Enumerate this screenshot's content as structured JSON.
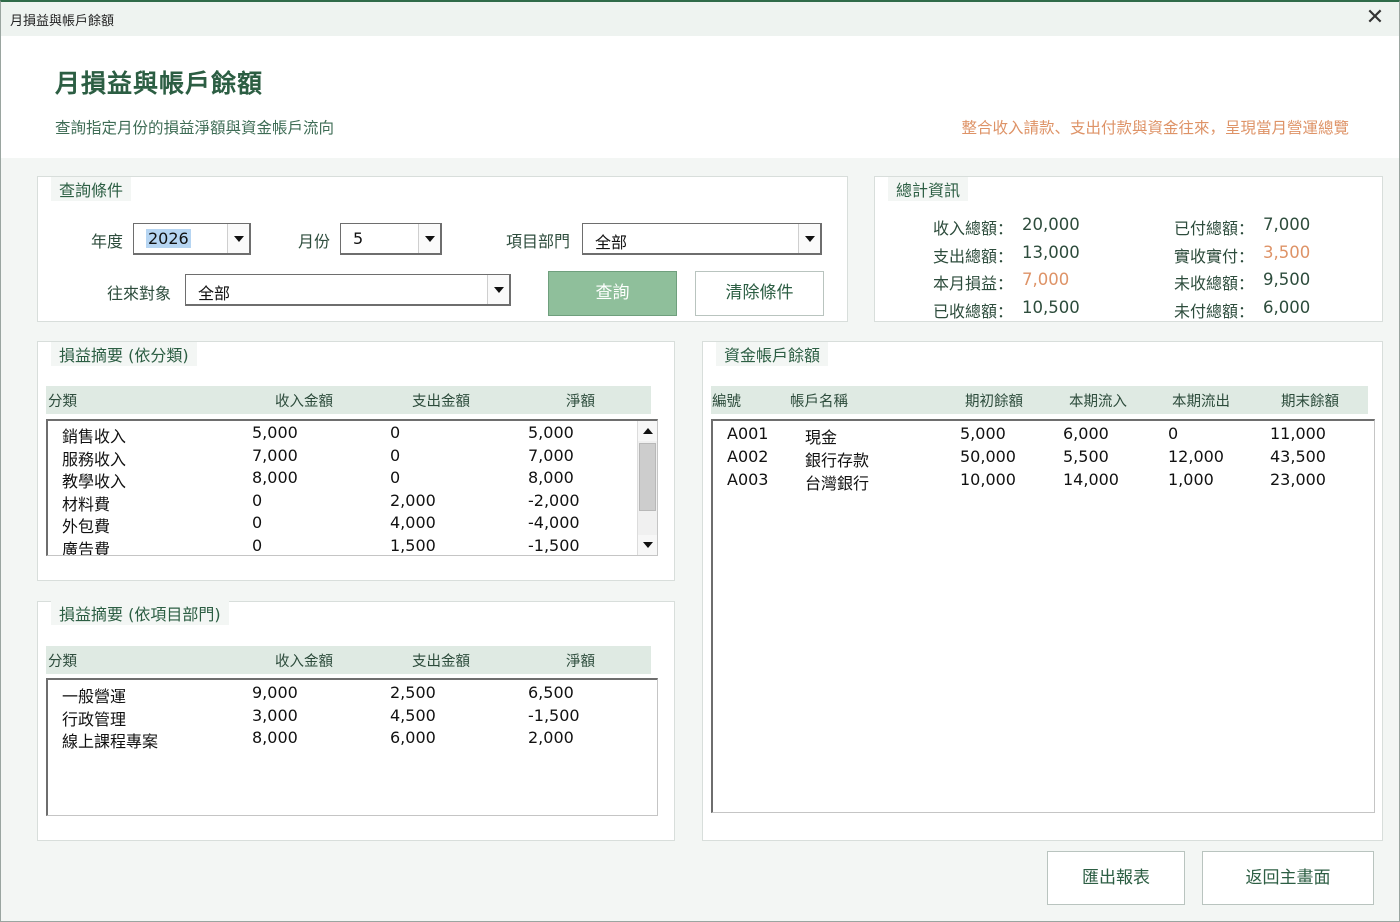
{
  "window": {
    "title": "月損益與帳戶餘額",
    "close_glyph": "✕"
  },
  "banner": {
    "heading": "月損益與帳戶餘額",
    "subtitle": "查詢指定月份的損益淨額與資金帳戶流向",
    "tagline": "整合收入請款、支出付款與資金往來，呈現當月營運總覽"
  },
  "query": {
    "frame_label": "查詢條件",
    "year_label": "年度",
    "year_value": "2026",
    "month_label": "月份",
    "month_value": "5",
    "dept_label": "項目部門",
    "dept_value": "全部",
    "party_label": "往來對象",
    "party_value": "全部",
    "search_button": "查詢",
    "clear_button": "清除條件"
  },
  "totals": {
    "frame_label": "總計資訊",
    "income_label": "收入總額：",
    "income_value": "20,000",
    "expense_label": "支出總額：",
    "expense_value": "13,000",
    "profit_label": "本月損益：",
    "profit_value": "7,000",
    "received_label": "已收總額：",
    "received_value": "10,500",
    "paid_label": "已付總額：",
    "paid_value": "7,000",
    "net_cash_label": "實收實付：",
    "net_cash_value": "3,500",
    "unreceived_label": "未收總額：",
    "unreceived_value": "9,500",
    "unpaid_label": "未付總額：",
    "unpaid_value": "6,000"
  },
  "by_category": {
    "frame_label": "損益摘要 (依分類)",
    "headers": [
      "分類",
      "收入金額",
      "支出金額",
      "淨額"
    ],
    "rows": [
      [
        "銷售收入",
        "5,000",
        "0",
        "5,000"
      ],
      [
        "服務收入",
        "7,000",
        "0",
        "7,000"
      ],
      [
        "教學收入",
        "8,000",
        "0",
        "8,000"
      ],
      [
        "材料費",
        "0",
        "2,000",
        "-2,000"
      ],
      [
        "外包費",
        "0",
        "4,000",
        "-4,000"
      ],
      [
        "廣告費",
        "0",
        "1,500",
        "-1,500"
      ]
    ]
  },
  "by_department": {
    "frame_label": "損益摘要 (依項目部門)",
    "headers": [
      "分類",
      "收入金額",
      "支出金額",
      "淨額"
    ],
    "rows": [
      [
        "一般營運",
        "9,000",
        "2,500",
        "6,500"
      ],
      [
        "行政管理",
        "3,000",
        "4,500",
        "-1,500"
      ],
      [
        "線上課程專案",
        "8,000",
        "6,000",
        "2,000"
      ]
    ]
  },
  "accounts": {
    "frame_label": "資金帳戶餘額",
    "headers": [
      "編號",
      "帳戶名稱",
      "期初餘額",
      "本期流入",
      "本期流出",
      "期末餘額"
    ],
    "rows": [
      [
        "A001",
        "現金",
        "5,000",
        "6,000",
        "0",
        "11,000"
      ],
      [
        "A002",
        "銀行存款",
        "50,000",
        "5,500",
        "12,000",
        "43,500"
      ],
      [
        "A003",
        "台灣銀行",
        "10,000",
        "14,000",
        "1,000",
        "23,000"
      ]
    ]
  },
  "footer": {
    "export_button": "匯出報表",
    "back_button": "返回主畫面"
  }
}
